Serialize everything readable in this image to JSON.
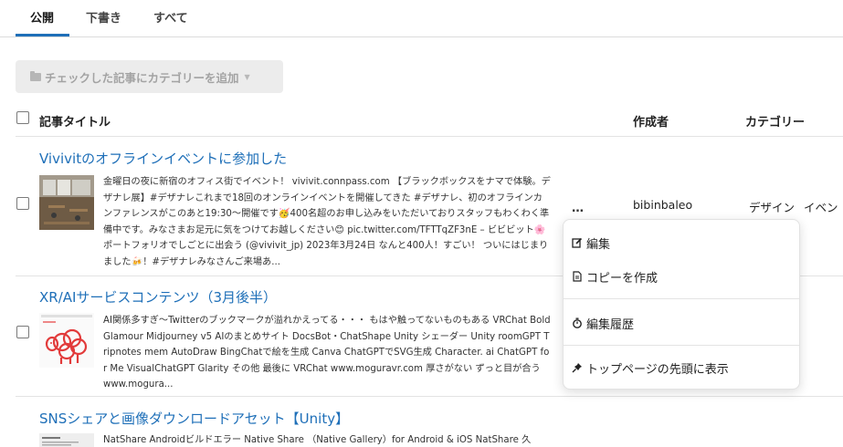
{
  "tabs": [
    {
      "label": "公開",
      "active": true
    },
    {
      "label": "下書き",
      "active": false
    },
    {
      "label": "すべて",
      "active": false
    }
  ],
  "bulk_category_button": {
    "label": "チェックした記事にカテゴリーを追加"
  },
  "table_headers": {
    "title": "記事タイトル",
    "author": "作成者",
    "category": "カテゴリー"
  },
  "posts": [
    {
      "title": "Vivivitのオフラインイベントに参加した",
      "excerpt": "金曜日の夜に新宿のオフィス街でイベント！ vivivit.connpass.com 【ブラックボックスをナマで体験。デザナレ展】#デザナレこれまで18回のオンラインイベントを開催してきた #デザナレ、初のオフラインカンファレンスがこのあと19:30〜開催です🥳400名超のお申し込みをいただいておりスタッフもわくわく準備中です。みなさまお足元に気をつけてお越しください😊 pic.twitter.com/TFTTqZF3nE – ビビビット🌸ポートフォリオでしごとに出会う (@vivivit_jp) 2023年3月24日 なんと400人！すごい！ ついにはじまりました🍻！#デザナレみなさんご来場あ...",
      "author": "bibinbaleo",
      "category": "デザイン イベン",
      "thumb_icon": "photo-thumbnail-icon"
    },
    {
      "title": "XR/AIサービスコンテンツ（3月後半）",
      "excerpt": "AI関係多すぎ〜Twitterのブックマークが溢れかえってる・・・ もはや触ってないものもある VRChat Bold Glamour Midjourney v5 AIのまとめサイト DocsBot・ChatShape Unity シェーダー Unity roomGPT Tripnotes mem AutoDraw BingChatで絵を生成 Canva ChatGPTでSVG生成 Character. ai ChatGPT for Me VisualChatGPT Glarity その他 最後に VRChat www.moguravr.com 厚さがない ずっと目が合う www.mogura...",
      "thumb_icon": "sheep-illustration-icon"
    },
    {
      "title": "SNSシェアと画像ダウンロードアセット【Unity】",
      "excerpt": "NatShare Androidビルドエラー Native Share （Native Gallery）for Android & iOS NatShare 久",
      "thumb_icon": "document-thumbnail-icon"
    }
  ],
  "row_menu": {
    "toggle_label": "…",
    "items": [
      {
        "label": "編集",
        "icon": "edit-icon"
      },
      {
        "label": "コピーを作成",
        "icon": "document-icon"
      },
      {
        "label": "編集履歴",
        "icon": "stopwatch-icon"
      },
      {
        "label": "トップページの先頭に表示",
        "icon": "pin-icon"
      }
    ]
  },
  "colors": {
    "accent": "#1e6fb8",
    "link": "#1e6fb8",
    "tab_underline": "#1e6fb8"
  }
}
